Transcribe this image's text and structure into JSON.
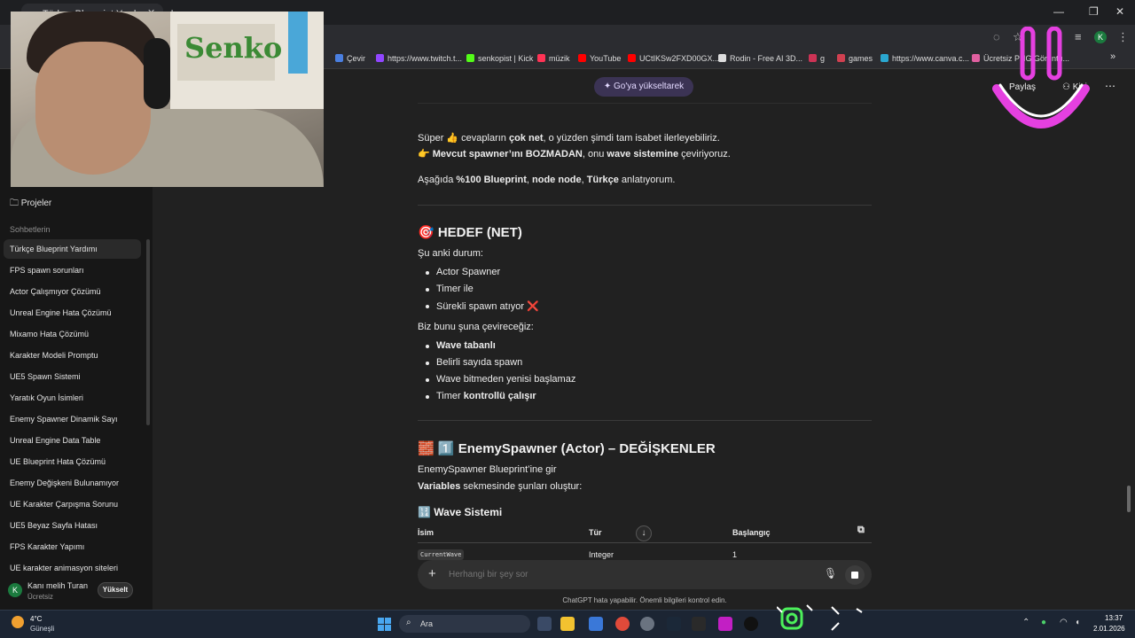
{
  "browser": {
    "tab_title": "Türkçe Blueprint Yardımı",
    "tab_close": "✕",
    "new_tab": "+",
    "window_controls": [
      "—",
      "❐",
      "✕"
    ],
    "bookmarks": [
      {
        "label": "Çevir",
        "color": "#4a7fe0"
      },
      {
        "label": "https://www.twitch.t...",
        "color": "#9146ff"
      },
      {
        "label": "senkopist | Kick",
        "color": "#53fc18"
      },
      {
        "label": "müzik",
        "color": "#ff3355"
      },
      {
        "label": "YouTube",
        "color": "#ff0000"
      },
      {
        "label": "UCtIKSw2FXD00GX...",
        "color": "#ff0000"
      },
      {
        "label": "Rodin - Free AI 3D...",
        "color": "#dddddd"
      },
      {
        "label": "g",
        "color": "#cc3355"
      },
      {
        "label": "games",
        "color": "#d04050"
      },
      {
        "label": "https://www.canva.c...",
        "color": "#2aa7d0"
      },
      {
        "label": "Ücretsiz PNG Görüntü...",
        "color": "#e060a0"
      }
    ],
    "profile_initial": "K"
  },
  "header": {
    "upgrade_label": "Go'ya yükseltarek",
    "share_label": "Paylaş",
    "private_label": "Kişi",
    "more": "⋯"
  },
  "sidebar": {
    "projects_label": "Projeler",
    "section_label": "Sohbetlerin",
    "items": [
      "Türkçe Blueprint Yardımı",
      "FPS spawn sorunları",
      "Actor Çalışmıyor Çözümü",
      "Unreal Engine Hata Çözümü",
      "Mixamo Hata Çözümü",
      "Karakter Modeli Promptu",
      "UE5 Spawn Sistemi",
      "Yaratık Oyun İsimleri",
      "Enemy Spawner Dinamik Sayı",
      "Unreal Engine Data Table",
      "UE Blueprint Hata Çözümü",
      "Enemy Değişkeni Bulunamıyor",
      "UE Karakter Çarpışma Sorunu",
      "UE5 Beyaz Sayfa Hatası",
      "FPS Karakter Yapımı",
      "UE karakter animasyon siteleri"
    ],
    "user": {
      "initial": "K",
      "name": "Kanı melih Turan",
      "plan": "Ücretsiz",
      "upgrade": "Yükselt"
    }
  },
  "chat": {
    "p1_a": "Süper 👍 cevapların ",
    "p1_b": "çok net",
    "p1_c": ", o yüzden şimdi tam isabet ilerleyebiliriz.",
    "p2_a": "👉 ",
    "p2_b": "Mevcut spawner’ını BOZMADAN",
    "p2_c": ", onu ",
    "p2_d": "wave sistemine",
    "p2_e": " çeviriyoruz.",
    "p3_a": "Aşağıda ",
    "p3_b": "%100 Blueprint",
    "p3_c": ", ",
    "p3_d": "node node",
    "p3_e": ", ",
    "p3_f": "Türkçe",
    "p3_g": " anlatıyorum.",
    "goal_heading": "🎯 HEDEF (NET)",
    "current_label": "Şu anki durum:",
    "current_items": [
      "Actor Spawner",
      "Timer ile",
      "Sürekli spawn atıyor ❌"
    ],
    "convert_label": "Biz bunu şuna çevireceğiz:",
    "convert_1": "Wave tabanlı",
    "convert_2": "Belirli sayıda spawn",
    "convert_3": "Wave bitmeden yenisi başlamaz",
    "convert_4a": "Timer ",
    "convert_4b": "kontrollü çalışır",
    "step_heading": "🧱 1️⃣ EnemySpawner (Actor) – DEĞİŞKENLER",
    "step_p1": "EnemySpawner Blueprint’ine gir",
    "step_p2a": "Variables",
    "step_p2b": " sekmesinde şunları oluştur:",
    "wave_heading": "🔢 Wave Sistemi",
    "table_headers": [
      "İsim",
      "Tür",
      "Başlangıç"
    ],
    "table_row": [
      "CurrentWave",
      "Integer",
      "1"
    ]
  },
  "composer": {
    "placeholder": "Herhangi bir şey sor",
    "plus": "+",
    "mic": "🎤",
    "disclaimer": "ChatGPT hata yapabilir. Önemli bilgileri kontrol edin."
  },
  "overlay": {
    "poster_text": "Senko"
  },
  "taskbar": {
    "temp": "4°C",
    "condition": "Güneşli",
    "search": "Ara",
    "time": "13:37",
    "date": "2.01.2026"
  }
}
